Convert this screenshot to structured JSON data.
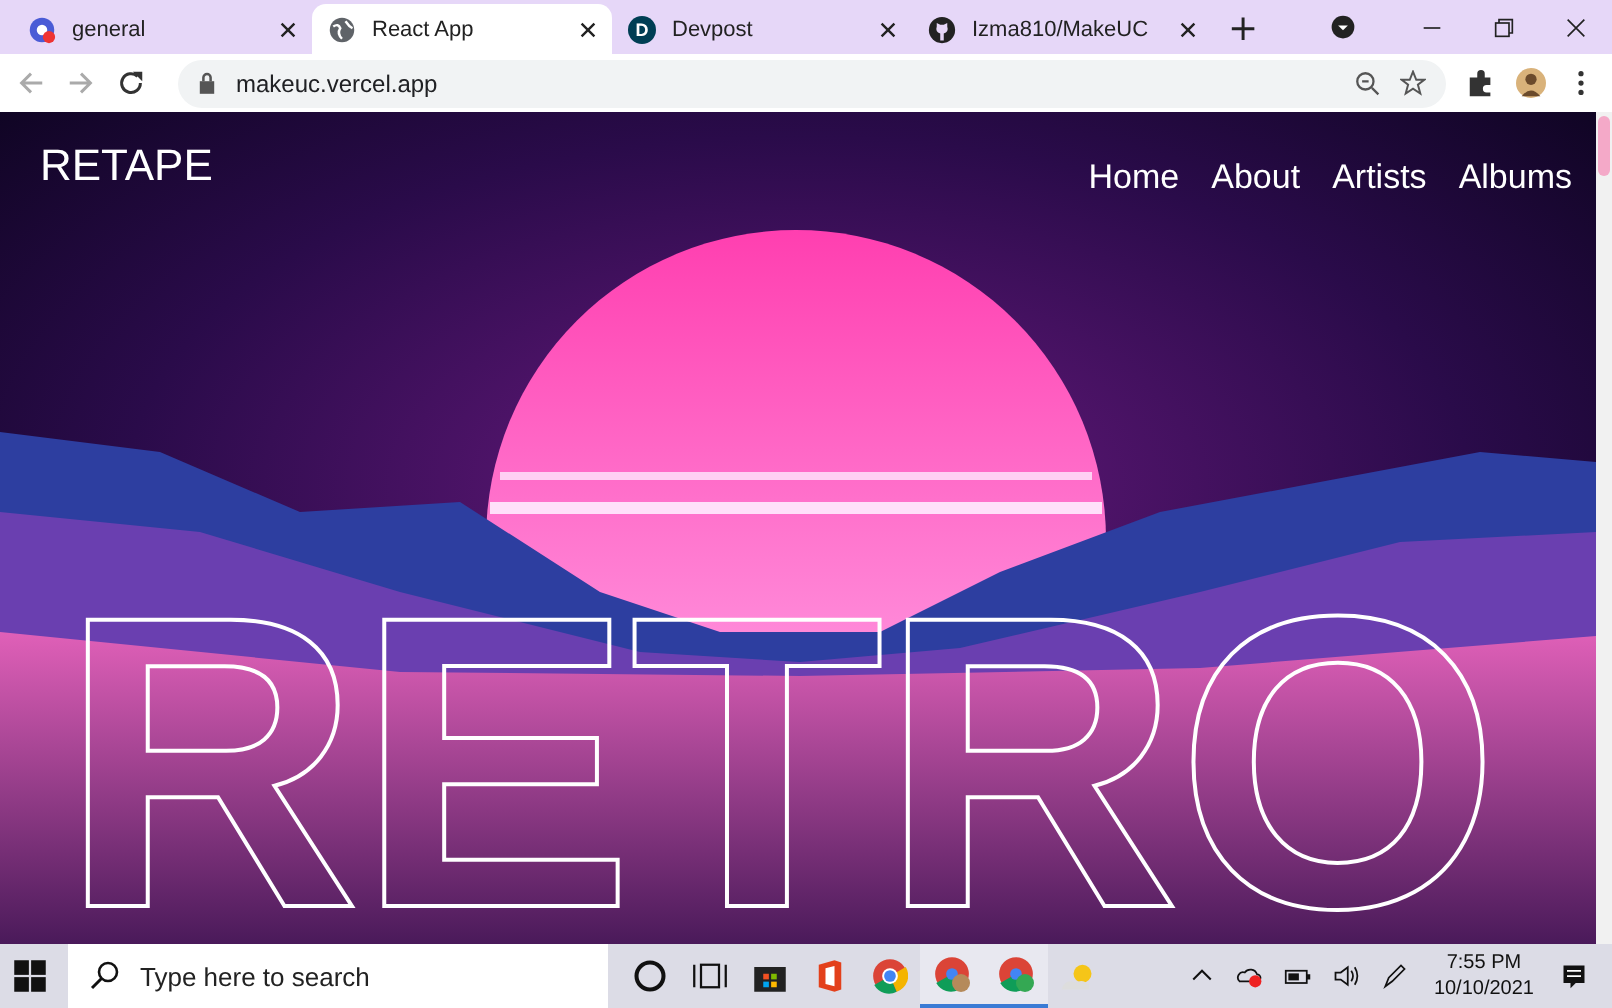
{
  "browser": {
    "tabs": [
      {
        "title": "general",
        "selected": false,
        "kind": "app"
      },
      {
        "title": "React App",
        "selected": true,
        "kind": "globe"
      },
      {
        "title": "Devpost",
        "selected": false,
        "kind": "letter",
        "letter": "D"
      },
      {
        "title": "Izma810/MakeUC",
        "selected": false,
        "kind": "github"
      }
    ],
    "new_tab": "+",
    "address": "makeuc.vercel.app"
  },
  "page": {
    "logo": "RETAPE",
    "nav": [
      {
        "label": "Home"
      },
      {
        "label": "About"
      },
      {
        "label": "Artists"
      },
      {
        "label": "Albums"
      }
    ],
    "hero_title": "RETRO"
  },
  "taskbar": {
    "search_placeholder": "Type here to search",
    "time": "7:55 PM",
    "date": "10/10/2021"
  }
}
